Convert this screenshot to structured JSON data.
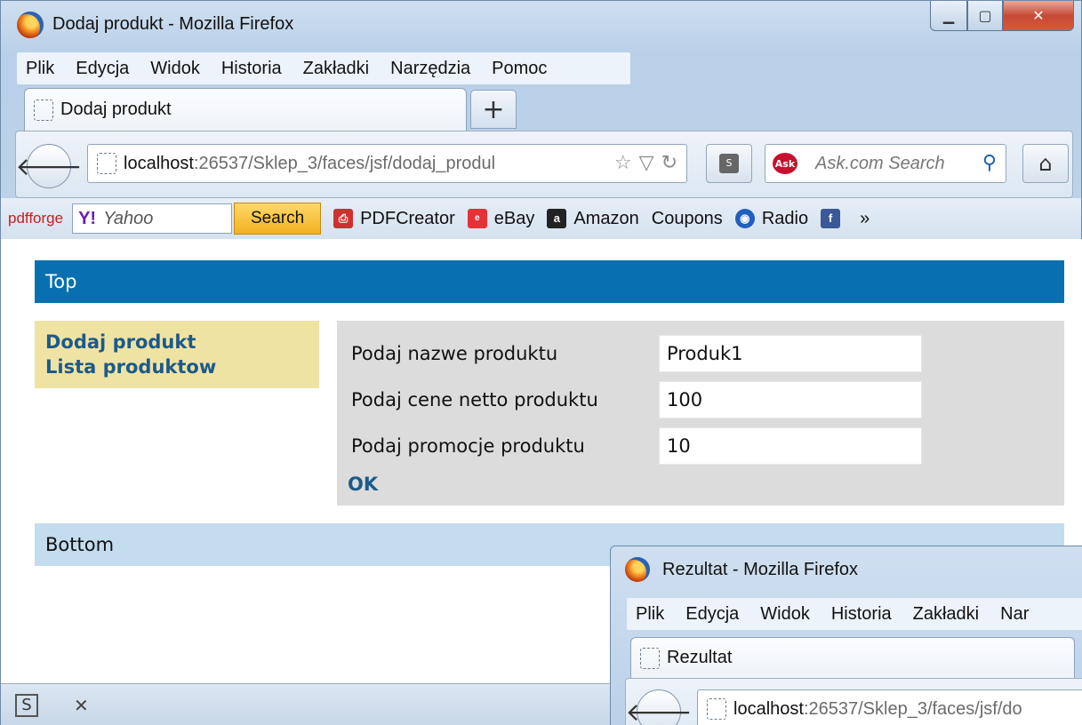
{
  "main_window": {
    "title": "Dodaj produkt - Mozilla Firefox",
    "menu": [
      "Plik",
      "Edycja",
      "Widok",
      "Historia",
      "Zakładki",
      "Narzędzia",
      "Pomoc"
    ],
    "tab_label": "Dodaj produkt",
    "new_tab": "+",
    "url_host": "localhost",
    "url_rest": ":26537/Sklep_3/faces/jsf/dodaj_produl",
    "search_placeholder": "Ask.com Search",
    "bookmarks": {
      "pdfforge": "pdfforge",
      "yahoo_placeholder": "Yahoo",
      "search_button": "Search",
      "items": [
        "PDFCreator",
        "eBay",
        "Amazon",
        "Coupons",
        "Radio"
      ],
      "overflow": "»"
    }
  },
  "page": {
    "top": "Top",
    "nav_links": [
      "Dodaj produkt",
      "Lista produktow"
    ],
    "form": {
      "name_label": "Podaj nazwe produktu",
      "name_value": "Produk1",
      "price_label": "Podaj cene netto produktu",
      "price_value": "100",
      "promo_label": "Podaj promocje produktu",
      "promo_value": "10",
      "submit": "OK"
    },
    "bottom": "Bottom"
  },
  "second_window": {
    "title": "Rezultat - Mozilla Firefox",
    "menu": [
      "Plik",
      "Edycja",
      "Widok",
      "Historia",
      "Zakładki",
      "Nar"
    ],
    "tab_label": "Rezultat",
    "url_host": "localhost",
    "url_rest": ":26537/Sklep_3/faces/jsf/do"
  },
  "colors": {
    "top_band": "#0870b0",
    "bottom_band": "#c3dcee",
    "left_nav": "#efe3a4",
    "form_bg": "#dcdcdc",
    "link": "#1c5a8a"
  }
}
